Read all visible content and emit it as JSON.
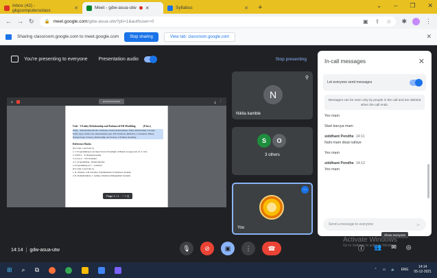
{
  "browser": {
    "tabs": [
      {
        "label": "Inbox (42) - gkgcomputersclass",
        "color": "#d93025"
      },
      {
        "label": "Meet - gdw-asua-utw",
        "color": "#00832d"
      },
      {
        "label": "Syllabus",
        "color": "#1a73e8"
      }
    ],
    "new_tab": "+",
    "url_host": "meet.google.com",
    "url_path": "/gdw-asua-utw?pli=1&authuser=0"
  },
  "sharing_bar": {
    "text": "Sharing classroom.google.com to meet.google.com",
    "stop_label": "Stop sharing",
    "view_label": "View tab: classroom.google.com"
  },
  "presenting": {
    "text": "You're presenting to everyone",
    "audio_label": "Presentation audio",
    "stop_label": "Stop presenting"
  },
  "document": {
    "heading": "Unit - 3 Entity Relationship and Enhanced ER Modeling",
    "hours": "(8 hrs.)",
    "lines": [
      "Entity - Relationship Model, Attributes, Entity Relationships, Entity Relationship concepts,",
      "Entity types, Entity sets, Relationship types, ER Notations, Reflexive, Constraints, Binary",
      "Design Issues, Ternary, Relationship and Ternary of Entities modeling"
    ],
    "sec1": "Reference Books",
    "sec1_sub": "(For Unit 1 and Unit 3)",
    "refs": [
      "1. C Programming in an Open Source Paradigm: A Hands on Approach, K. S. Oza",
      "2. ANSI C - E. Balaguruswamy",
      "3. Let us C - Y.P. Kanetkar",
      "4. C programming - Dennis Ritchie",
      "5. Programming in C - Gottfried"
    ],
    "sec2_sub": "(For Unit 2 and Unit 4)",
    "refs2": [
      "1. R. Elmasri, S.B. Navathe, Fundamentals of Database Systems",
      "2. R. Ramakrishnan, J. Gehrke, Database Management Systems"
    ],
    "pdf_page": "Page 1 / 1",
    "pdf_zoom": "− +  Q"
  },
  "tiles": {
    "nikita": {
      "initial": "N",
      "name": "Nikita kamble"
    },
    "others": {
      "a": "S",
      "b": "O",
      "label": "3 others"
    },
    "you": {
      "name": "You"
    }
  },
  "chat": {
    "title": "In-call messages",
    "setting": "Let everyone send messages",
    "notice": "Messages can be seen only by people in the call and are deleted when the call ends.",
    "messages": [
      {
        "lines": [
          "Yes mam",
          "Start karuya mam"
        ]
      },
      {
        "sender": "siddhant Pendhe",
        "time": "14:11",
        "lines": [
          "Nahi mam disat nahiye",
          "Yes mam"
        ]
      },
      {
        "sender": "siddhant Pendhe",
        "time": "14:12",
        "lines": [
          "Yes mam"
        ]
      }
    ],
    "placeholder": "Send a message to everyone"
  },
  "footer": {
    "time": "14:14",
    "separator": "|",
    "code": "gdw-asua-utw",
    "tooltip": "Show everyone",
    "activate": "Activate Windows",
    "activate_sub": "Go to Settings to activate Windows."
  },
  "taskbar": {
    "lang": "ENG",
    "clock_time": "14:14",
    "clock_date": "05-12-2021"
  }
}
